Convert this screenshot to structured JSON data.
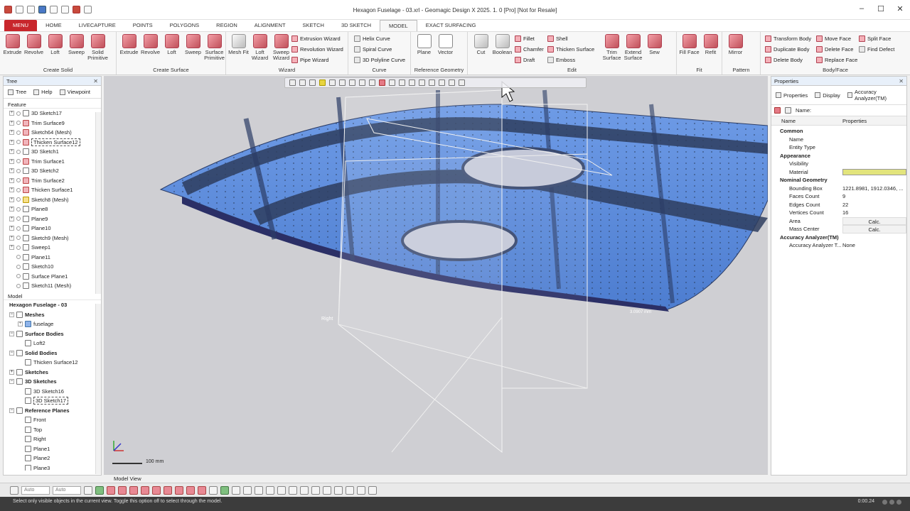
{
  "app": {
    "title": "Hexagon Fuselage - 03.xrl - Geomagic Design X 2025. 1. 0 [Pro] [Not for Resale]",
    "win_min": "–",
    "win_max": "☐",
    "win_close": "✕"
  },
  "menubar": {
    "menu": "MENU",
    "tabs": [
      "HOME",
      "LIVECAPTURE",
      "POINTS",
      "POLYGONS",
      "REGION",
      "ALIGNMENT",
      "SKETCH",
      "3D SKETCH",
      "MODEL",
      "EXACT SURFACING"
    ]
  },
  "ribbon": {
    "create_solid": {
      "label": "Create Solid",
      "buttons": [
        "Extrude",
        "Revolve",
        "Loft",
        "Sweep",
        "Solid Primitive"
      ]
    },
    "create_surface": {
      "label": "Create Surface",
      "buttons": [
        "Extrude",
        "Revolve",
        "Loft",
        "Sweep",
        "Surface Primitive"
      ]
    },
    "wizard": {
      "label": "Wizard",
      "buttons": [
        "Mesh Fit",
        "Loft Wizard",
        "Sweep Wizard"
      ],
      "list": [
        "Extrusion Wizard",
        "Revolution Wizard",
        "Pipe Wizard"
      ]
    },
    "curve": {
      "label": "Curve",
      "list": [
        "Helix Curve",
        "Spiral Curve",
        "3D Polyline Curve"
      ]
    },
    "ref_geometry": {
      "label": "Reference Geometry",
      "buttons": [
        "Plane",
        "Vector"
      ]
    },
    "edit": {
      "label": "Edit",
      "buttons": [
        "Cut",
        "Boolean"
      ],
      "list1": [
        "Fillet",
        "Chamfer",
        "Draft"
      ],
      "list2": [
        "Shell",
        "Thicken Surface",
        "Emboss"
      ],
      "buttons2": [
        "Trim Surface",
        "Extend Surface",
        "Sew"
      ]
    },
    "fit": {
      "label": "Fit",
      "buttons": [
        "Fill Face",
        "Refit"
      ]
    },
    "pattern": {
      "label": "Pattern",
      "buttons": [
        "Mirror"
      ]
    },
    "bodyface": {
      "label": "Body/Face",
      "list1": [
        "Transform Body",
        "Duplicate Body",
        "Delete Body"
      ],
      "list2": [
        "Move Face",
        "Delete Face",
        "Replace Face"
      ],
      "list3": [
        "Split Face",
        "Find Defect"
      ]
    }
  },
  "leftpanel": {
    "header": "Tree",
    "tabs": [
      "Tree",
      "Help",
      "Viewpoint"
    ],
    "feature_label": "Feature",
    "features": [
      "3D Sketch17",
      "Trim Surface9",
      "Sketch64 (Mesh)",
      "Thicken Surface12",
      "3D Sketch1",
      "Trim Surface1",
      "3D Sketch2",
      "Trim Surface2",
      "Thicken Surface1",
      "Sketch8 (Mesh)",
      "Plane8",
      "Plane9",
      "Plane10",
      "Sketch9 (Mesh)",
      "Sweep1",
      "Plane11",
      "Sketch10",
      "Surface Plane1",
      "Sketch11 (Mesh)"
    ],
    "model_label": "Model",
    "model_tree": [
      "Hexagon Fuselage - 03",
      "Meshes",
      "fuselage",
      "Surface Bodies",
      "Loft2",
      "Solid Bodies",
      "Thicken Surface12",
      "Sketches",
      "3D Sketches",
      "3D Sketch16",
      "3D Sketch17",
      "Reference Planes",
      "Front",
      "Top",
      "Right",
      "Plane1",
      "Plane2",
      "Plane3"
    ]
  },
  "viewport": {
    "plane_label": "Right",
    "dim_label": "3.0907 mm",
    "scale_label": "100 mm",
    "tab": "Model View"
  },
  "rightpanel": {
    "header": "Properties",
    "tabs": [
      "Properties",
      "Display",
      "Accuracy Analyzer(TM)"
    ],
    "name_label": "Name:",
    "col_name": "Name",
    "col_props": "Properties",
    "rows": [
      {
        "k": "Common",
        "v": "",
        "cat": true
      },
      {
        "k": "Name",
        "v": ""
      },
      {
        "k": "Entity Type",
        "v": ""
      },
      {
        "k": "Appearance",
        "v": "",
        "cat": true
      },
      {
        "k": "Visibility",
        "v": ""
      },
      {
        "k": "Material",
        "v": "",
        "swatch": true
      },
      {
        "k": "Nominal Geometry",
        "v": "",
        "cat": true
      },
      {
        "k": "Bounding Box",
        "v": "1221.8981, 1912.0346, ..."
      },
      {
        "k": "Faces Count",
        "v": "9"
      },
      {
        "k": "Edges Count",
        "v": "22"
      },
      {
        "k": "Vertices Count",
        "v": "16"
      },
      {
        "k": "Area",
        "v": "Calc.",
        "btn": true
      },
      {
        "k": "Mass Center",
        "v": "Calc.",
        "btn": true
      },
      {
        "k": "Accuracy Analyzer(TM)",
        "v": "",
        "cat": true
      },
      {
        "k": "Accuracy Analyzer T...",
        "v": "None"
      }
    ]
  },
  "bottombar": {
    "sel1": "Auto",
    "sel2": "Auto"
  },
  "status": {
    "hint": "Select only visible objects in the current view. Toggle this option off to select through the model.",
    "time": "0:00.24"
  },
  "colors": {
    "menu_red": "#c8262c",
    "model_blue": "#5a8fe0",
    "bg": "#cfcfd3"
  }
}
